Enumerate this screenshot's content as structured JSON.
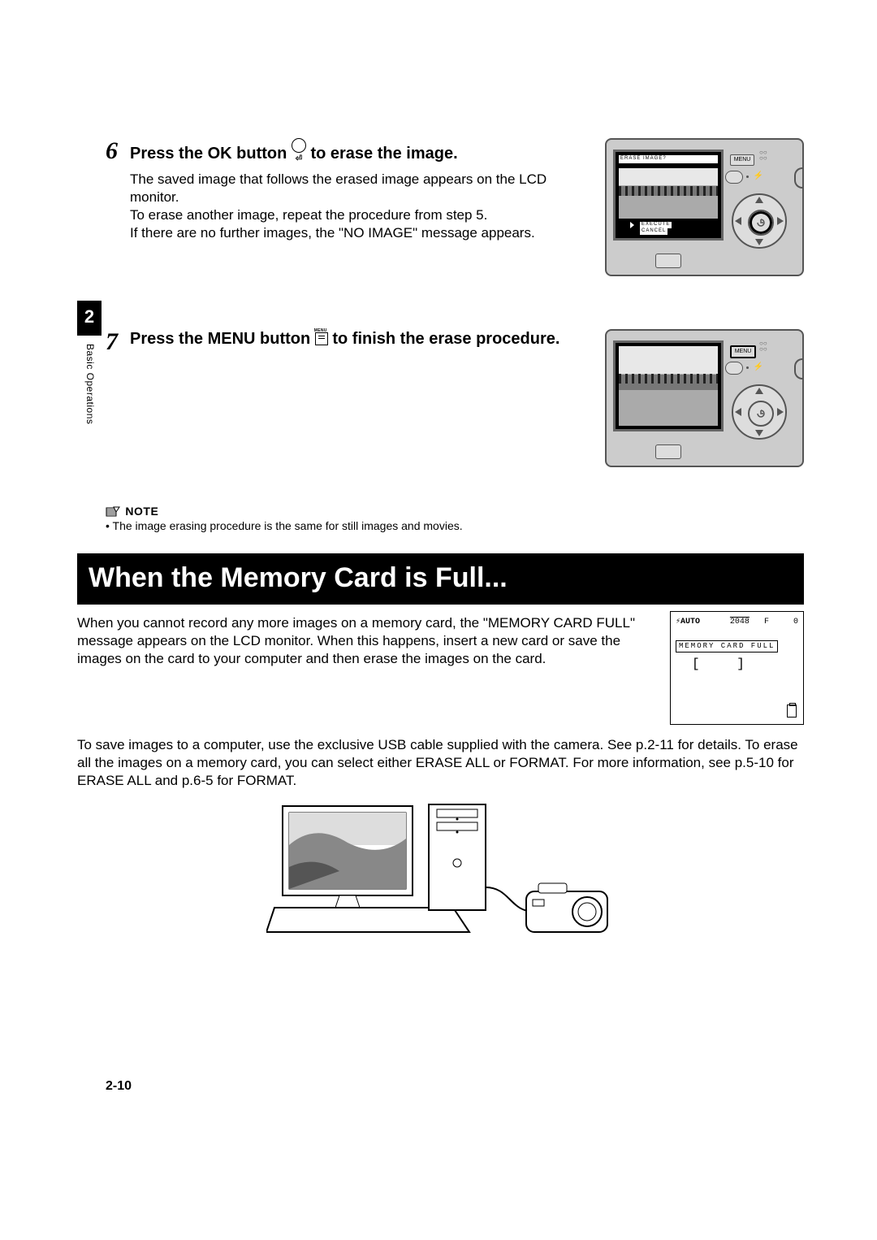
{
  "side": {
    "chapter_num": "2",
    "chapter_title": "Basic Operations"
  },
  "step6": {
    "num": "6",
    "heading_a": "Press the OK button ",
    "heading_b": " to erase the image.",
    "body_a": "The saved image that follows the erased image appears on the LCD monitor.",
    "body_b": "To erase another image, repeat the procedure from step 5.",
    "body_c": "If there are no further images, the \"NO IMAGE\" message appears.",
    "lcd_title": "ERASE IMAGE?",
    "lcd_opt1": "EXECUTE",
    "lcd_opt2": "CANCEL",
    "menu_label": "MENU"
  },
  "step7": {
    "num": "7",
    "heading_a": "Press the MENU button ",
    "heading_b": " to finish the erase procedure.",
    "menu_label": "MENU"
  },
  "note": {
    "label": "NOTE",
    "bullet": "• The image erasing procedure is the same for still images and movies."
  },
  "section": {
    "banner": "When the Memory Card is Full...",
    "para1": "When you cannot record any more images on a memory card, the \"MEMORY CARD FULL\" message appears on the LCD monitor. When this happens, insert a new card or save the images on the card to your computer and then erase the images on the card.",
    "para2": "To save images to a computer, use the exclusive USB cable supplied with the camera. See p.2-11 for details. To erase all the images on a memory card, you can select either ERASE ALL or FORMAT. For more information, see p.5-10 for ERASE ALL and p.6-5 for FORMAT.",
    "lcd": {
      "flash": "AUTO",
      "res": "2048",
      "qual": "F",
      "count": "0",
      "msg": "MEMORY CARD FULL",
      "brackets": "[  ]"
    }
  },
  "page_number": "2-10",
  "chart_data": null
}
